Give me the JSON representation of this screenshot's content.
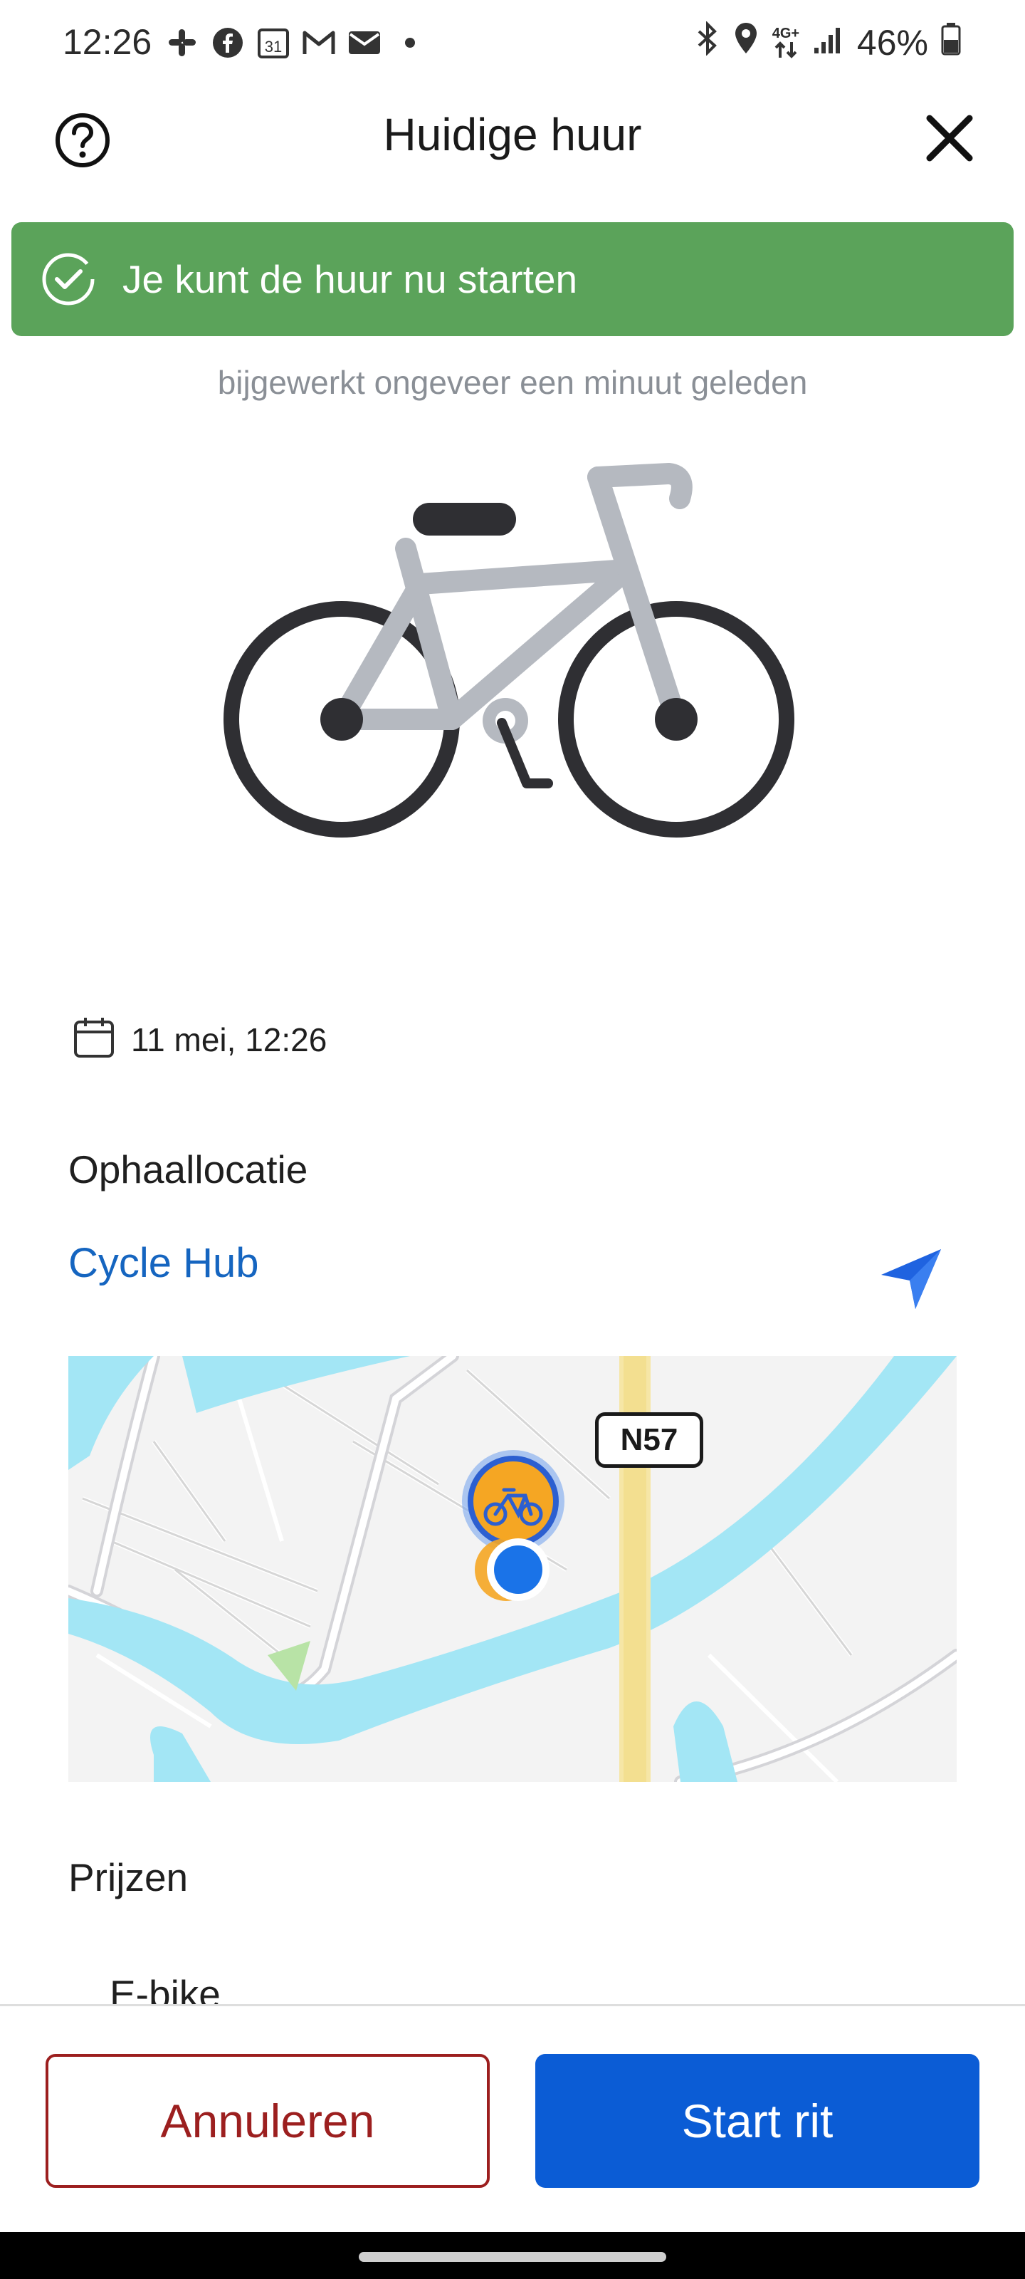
{
  "status_bar": {
    "time": "12:26",
    "calendar_day": "31",
    "battery": "46%",
    "network": "4G+",
    "left_icons": [
      "slack-icon",
      "facebook-icon",
      "calendar-icon",
      "gmail-icon",
      "mail-icon",
      "dot-icon"
    ],
    "right_icons": [
      "bluetooth-icon",
      "location-icon",
      "data-icon",
      "signal-icon",
      "battery-icon"
    ]
  },
  "header": {
    "title": "Huidige huur",
    "help_icon": "help-icon",
    "close_icon": "close-icon"
  },
  "banner": {
    "text": "Je kunt de huur nu starten",
    "color": "#5ba35a",
    "icon": "check-circle-icon"
  },
  "updated_text": "bijgewerkt ongeveer een minuut geleden",
  "vehicle_icon": "bicycle-icon",
  "rental": {
    "date": "11 mei, 12:26",
    "date_icon": "calendar-icon"
  },
  "pickup": {
    "section_title": "Ophaallocatie",
    "location_name": "Cycle Hub",
    "navigate_icon": "navigation-arrow-icon"
  },
  "map": {
    "road_label": "N57",
    "markers": [
      "bike-station-marker",
      "user-location-marker"
    ]
  },
  "prices": {
    "section_title": "Prijzen",
    "items": [
      "E-bike"
    ]
  },
  "actions": {
    "cancel_label": "Annuleren",
    "start_label": "Start rit",
    "cancel_color": "#9c1f1f",
    "start_color": "#0b5cd5"
  }
}
